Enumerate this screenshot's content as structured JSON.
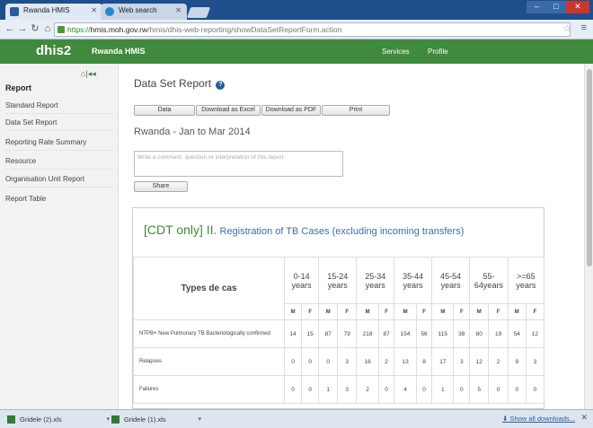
{
  "browser": {
    "tabs": [
      {
        "title": "Rwanda HMIS",
        "active": true
      },
      {
        "title": "Web search",
        "active": false
      }
    ],
    "url_scheme": "https://",
    "url_host": "hmis.moh.gov.rw",
    "url_path": "/hmis/dhis-web-reporting/showDataSetReportForm.action"
  },
  "app": {
    "logo": "dhis2",
    "org_name": "Rwanda HMIS",
    "nav": [
      "Services",
      "Profile"
    ],
    "brand_color": "#3f8a3c"
  },
  "sidebar": {
    "title": "Report",
    "items": [
      "Standard Report",
      "Data Set Report",
      "Reporting Rate Summary",
      "Resource",
      "Organisation Unit Report",
      "Report Table"
    ]
  },
  "main": {
    "title": "Data Set Report",
    "buttons": [
      "Data",
      "Download as Excel",
      "Download as PDF",
      "Print"
    ],
    "subtitle": "Rwanda - Jan to Mar 2014",
    "comment_placeholder": "Write a comment, question or interpretation of this report",
    "share_label": "Share",
    "report": {
      "header_prefix": "[CDT only]",
      "header_numeral": " II.",
      "header_rest": " Registration of TB Cases (excluding incoming transfers)",
      "types_label": "Types de cas",
      "age_groups": [
        "0-14 years",
        "15-24 years",
        "25-34 years",
        "35-44 years",
        "45-54 years",
        "55-64years",
        ">=65 years"
      ],
      "sex_labels": [
        "M",
        "F"
      ],
      "rows": [
        {
          "label": "NTPB+ New Pulmonary TB Bacteriologically confirmed",
          "values": [
            "14",
            "15",
            "87",
            "79",
            "218",
            "87",
            "154",
            "56",
            "115",
            "38",
            "80",
            "19",
            "54",
            "12"
          ]
        },
        {
          "label": "Relapses",
          "values": [
            "0",
            "0",
            "0",
            "3",
            "16",
            "2",
            "13",
            "8",
            "17",
            "3",
            "12",
            "2",
            "9",
            "3"
          ]
        },
        {
          "label": "Failures",
          "values": [
            "0",
            "0",
            "1",
            "3",
            "2",
            "0",
            "4",
            "0",
            "1",
            "0",
            "5",
            "0",
            "0",
            "0"
          ]
        }
      ]
    }
  },
  "downloads": {
    "items": [
      "Gridele (2).xls",
      "Gridele (1).xls"
    ],
    "show_all": "Show all downloads..."
  }
}
